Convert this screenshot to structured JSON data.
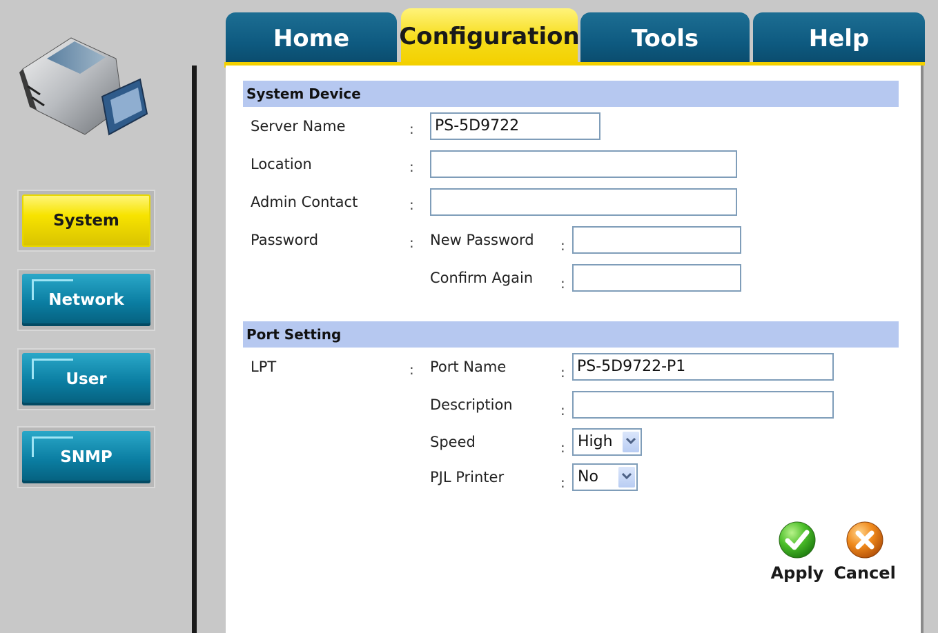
{
  "tabs": [
    {
      "label": "Home",
      "active": false
    },
    {
      "label": "Configuration",
      "active": true
    },
    {
      "label": "Tools",
      "active": false
    },
    {
      "label": "Help",
      "active": false
    }
  ],
  "sidebar": {
    "items": [
      {
        "label": "System",
        "active": true
      },
      {
        "label": "Network",
        "active": false
      },
      {
        "label": "User",
        "active": false
      },
      {
        "label": "SNMP",
        "active": false
      }
    ]
  },
  "system_device": {
    "header": "System Device",
    "server_name_label": "Server Name",
    "server_name_value": "PS-5D9722",
    "location_label": "Location",
    "location_value": "",
    "admin_contact_label": "Admin Contact",
    "admin_contact_value": "",
    "password_label": "Password",
    "new_password_label": "New Password",
    "new_password_value": "",
    "confirm_again_label": "Confirm Again",
    "confirm_again_value": ""
  },
  "port_setting": {
    "header": "Port Setting",
    "lpt_label": "LPT",
    "port_name_label": "Port Name",
    "port_name_value": "PS-5D9722-P1",
    "description_label": "Description",
    "description_value": "",
    "speed_label": "Speed",
    "speed_value": "High",
    "pjl_label": "PJL Printer",
    "pjl_value": "No"
  },
  "actions": {
    "apply_label": "Apply",
    "cancel_label": "Cancel"
  },
  "colon": ":",
  "colors": {
    "tab_active": "#f3d000",
    "tab_inactive": "#0e5a80",
    "section_header": "#b6c8f0",
    "nav_inactive": "#0b7ea2",
    "nav_active": "#f7e300"
  },
  "icons": {
    "apply": "green-check-icon",
    "cancel": "orange-x-icon",
    "select_arrow": "chevron-down-icon",
    "device": "print-server-device-image"
  }
}
